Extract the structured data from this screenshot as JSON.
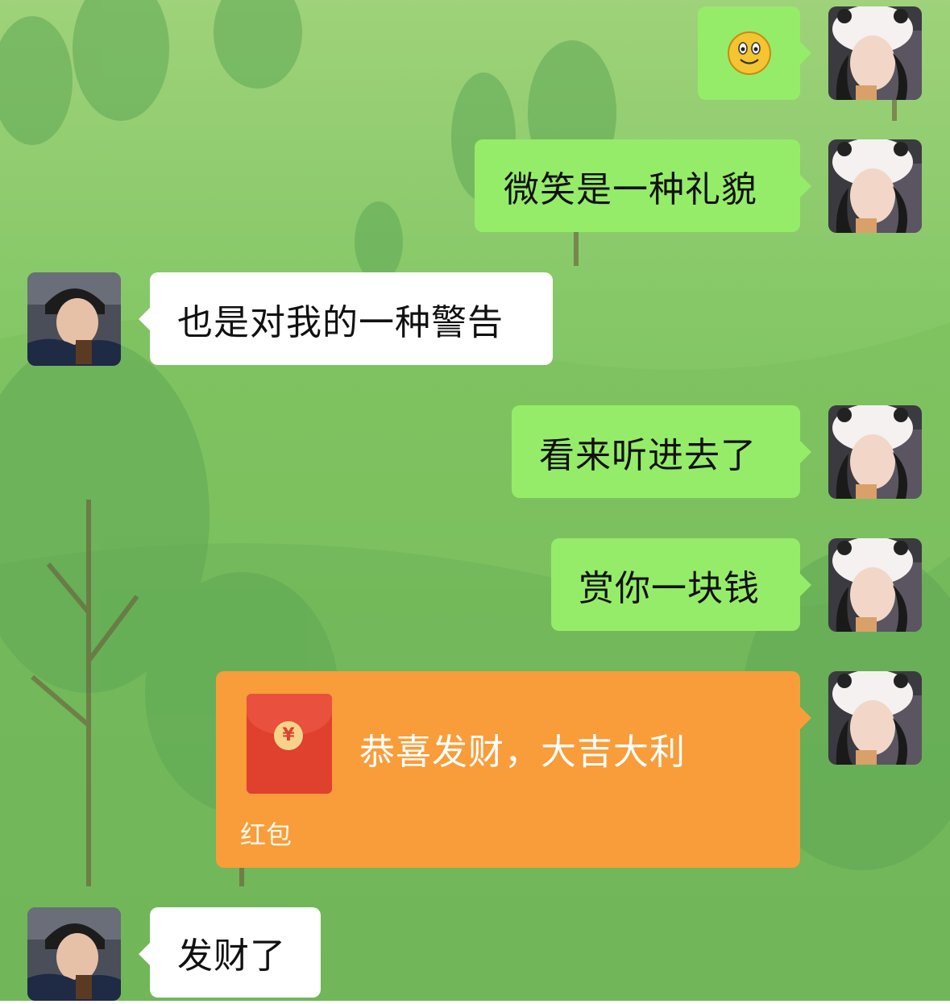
{
  "messages": [
    {
      "side": "right",
      "type": "emoji",
      "emoji_icon": "smile-emoji-icon"
    },
    {
      "side": "right",
      "type": "text",
      "text": "微笑是一种礼貌"
    },
    {
      "side": "left",
      "type": "text",
      "text": "也是对我的一种警告"
    },
    {
      "side": "right",
      "type": "text",
      "text": "看来听进去了"
    },
    {
      "side": "right",
      "type": "text",
      "text": "赏你一块钱"
    },
    {
      "side": "right",
      "type": "red_packet",
      "title": "恭喜发财，大吉大利",
      "label": "红包",
      "coin_symbol": "¥"
    },
    {
      "side": "left",
      "type": "text",
      "text": "发财了"
    }
  ],
  "colors": {
    "right_bubble": "#95ec69",
    "left_bubble": "#ffffff",
    "red_packet_bg": "#f89d3a",
    "red_packet_icon": "#e0402e"
  }
}
